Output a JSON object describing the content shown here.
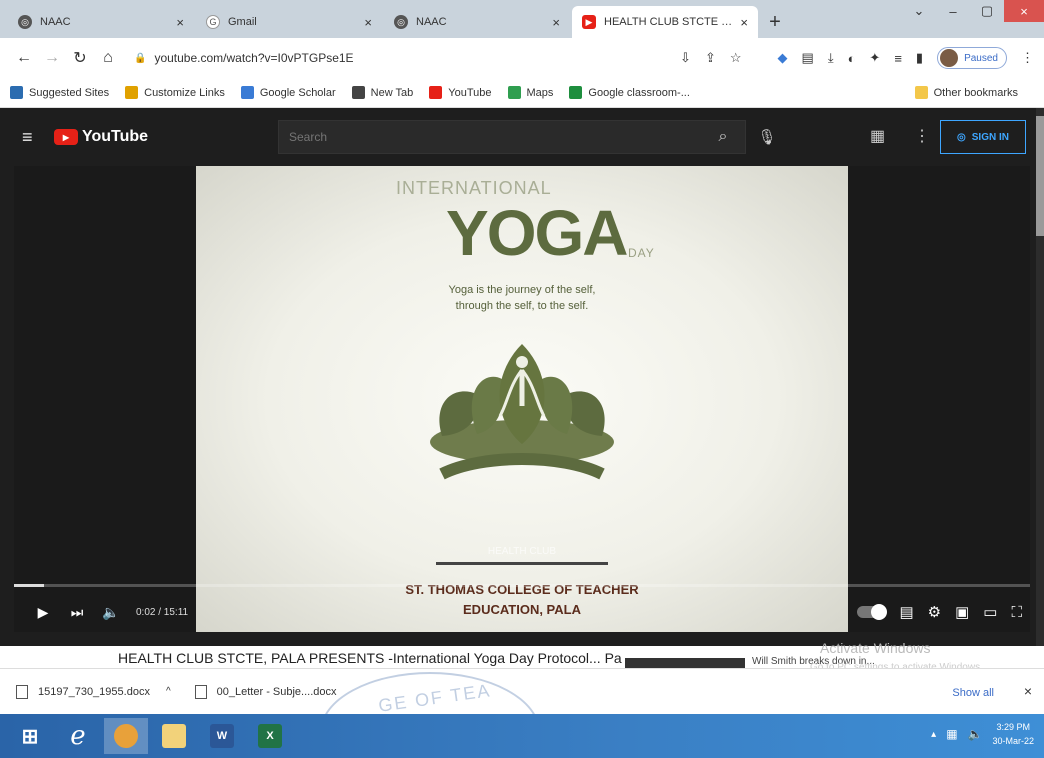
{
  "browser": {
    "tabs": [
      {
        "title": "NAAC",
        "icon": "globe-icon",
        "active": false
      },
      {
        "title": "Gmail",
        "icon": "gmail-icon",
        "active": false
      },
      {
        "title": "NAAC",
        "icon": "globe-icon",
        "active": false
      },
      {
        "title": "HEALTH CLUB STCTE PALA PRE",
        "icon": "youtube-icon",
        "active": true
      }
    ],
    "new_tab": "+",
    "window_controls": {
      "minimize": "–",
      "maximize": "▢",
      "close": "×"
    },
    "url": "youtube.com/watch?v=I0vPTGPse1E",
    "profile_status": "Paused",
    "bookmarks": [
      {
        "label": "Suggested Sites",
        "color": "#2b6cb0"
      },
      {
        "label": "Customize Links",
        "color": "#e0a100"
      },
      {
        "label": "Google Scholar",
        "color": "#3a7bd5"
      },
      {
        "label": "New Tab",
        "color": "#444444"
      },
      {
        "label": "YouTube",
        "color": "#e62117"
      },
      {
        "label": "Maps",
        "color": "#2f9e4f"
      },
      {
        "label": "Google classroom-...",
        "color": "#1e8e3e"
      }
    ],
    "other_bookmarks": "Other bookmarks"
  },
  "youtube": {
    "logo": "YouTube",
    "search_placeholder": "Search",
    "sign_in": "SIGN IN",
    "video": {
      "poster": {
        "line1": "INTERNATIONAL",
        "line2": "YOGA",
        "line3": "DAY",
        "tagline1": "Yoga is the journey of the self,",
        "tagline2": "through the self, to the self.",
        "club": "HEALTH CLUB",
        "college1": "ST. THOMAS COLLEGE OF TEACHER",
        "college2": "EDUCATION, PALA"
      },
      "time": "0:02 / 15:11",
      "progress": 0.03
    },
    "video_title": "HEALTH CLUB STCTE, PALA PRESENTS -International Yoga Day Protocol... Pa",
    "side_title": "Will Smith breaks down in..."
  },
  "watermark": {
    "line1": "Activate Windows",
    "line2": "Go to PC settings to activate Windows."
  },
  "downloads": {
    "items": [
      {
        "name": "15197_730_1955.docx"
      },
      {
        "name": "00_Letter - Subje....docx"
      }
    ],
    "show_all": "Show all"
  },
  "taskbar": {
    "time": "3:29 PM",
    "date": "30-Mar-22"
  }
}
